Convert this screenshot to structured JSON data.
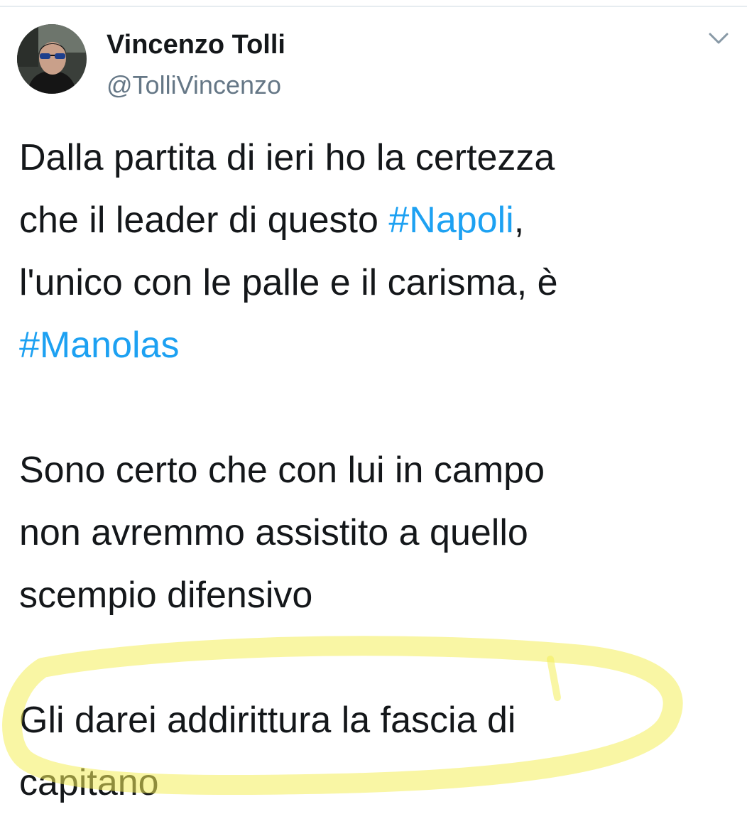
{
  "header": {
    "display_name": "Vincenzo Tolli",
    "handle": "@TolliVincenzo",
    "avatar_icon": "user-avatar-icon",
    "menu_icon": "chevron-down-icon"
  },
  "tweet": {
    "paragraph1": {
      "line1": "Dalla partita di ieri ho la certezza",
      "line2_prefix": "che il leader di questo ",
      "line2_hashtag": "#Napoli",
      "line2_suffix": ",",
      "line3": "l'unico con le palle e il carisma, è",
      "line4_hashtag": "#Manolas"
    },
    "paragraph2": {
      "line1": "Sono certo che con lui in campo",
      "line2": "non avremmo assistito a quello",
      "line3": "scempio difensivo"
    },
    "paragraph3": {
      "line1": "Gli darei addirittura la fascia di",
      "line2": "capitano"
    }
  },
  "colors": {
    "text": "#14171a",
    "secondary_text": "#657786",
    "hashtag": "#1da1f2",
    "highlight": "#f4ee5a"
  }
}
